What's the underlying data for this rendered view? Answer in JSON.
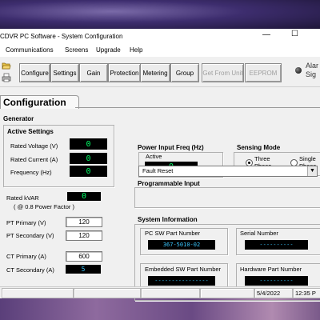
{
  "window": {
    "title": "CDVR PC Software - System Configuration",
    "minimize_glyph": "—",
    "maximize_glyph": "☐"
  },
  "menu": [
    "Communications",
    "Screens",
    "Upgrade",
    "Help"
  ],
  "toolbar": {
    "buttons": [
      "Configure",
      "Settings",
      "Gain",
      "Protection",
      "Metering",
      "Group",
      "Get From Unit",
      "EEPROM"
    ],
    "alarm_line1": "Alar",
    "alarm_line2": "Sig"
  },
  "page": {
    "tab": "Configuration"
  },
  "generator": {
    "title": "Generator",
    "active_settings_title": "Active Settings",
    "rated_voltage_label": "Rated Voltage (V)",
    "rated_voltage": "0",
    "rated_current_label": "Rated Current (A)",
    "rated_current": "0",
    "frequency_label": "Frequency (Hz)",
    "frequency": "0",
    "rated_kvar_label": "Rated kVAR",
    "rated_kvar": "0",
    "power_factor_note": "( @ 0.8 Power Factor )",
    "pt_primary_label": "PT Primary (V)",
    "pt_primary": "120",
    "pt_secondary_label": "PT Secondary (V)",
    "pt_secondary": "120",
    "ct_primary_label": "CT Primary (A)",
    "ct_primary": "600",
    "ct_secondary_label": "CT Secondary (A)",
    "ct_secondary": "5"
  },
  "power_input": {
    "title": "Power Input Freq (Hz)",
    "active_label": "Active",
    "active_value": "0"
  },
  "sensing": {
    "title": "Sensing Mode",
    "three_l1": "Three",
    "three_l2": "Phase",
    "single_l1": "Single",
    "single_l2": "Phase",
    "selected": "three"
  },
  "programmable": {
    "title": "Programmable Input",
    "value": "Fault Reset"
  },
  "system_info": {
    "title": "System Information",
    "pc_sw_label": "PC SW Part Number",
    "pc_sw_value": "367-5010-02",
    "serial_label": "Serial Number",
    "serial_value": "----------",
    "embedded_label": "Embedded SW Part Number",
    "embedded_value": "----------------",
    "hardware_label": "Hardware Part Number",
    "hardware_value": "----------"
  },
  "status": {
    "date": "5/4/2022",
    "time": "12:35 P"
  },
  "colors": {
    "display_bg": "#000000",
    "display_green": "#00ff66",
    "display_cyan": "#39c7ff"
  }
}
